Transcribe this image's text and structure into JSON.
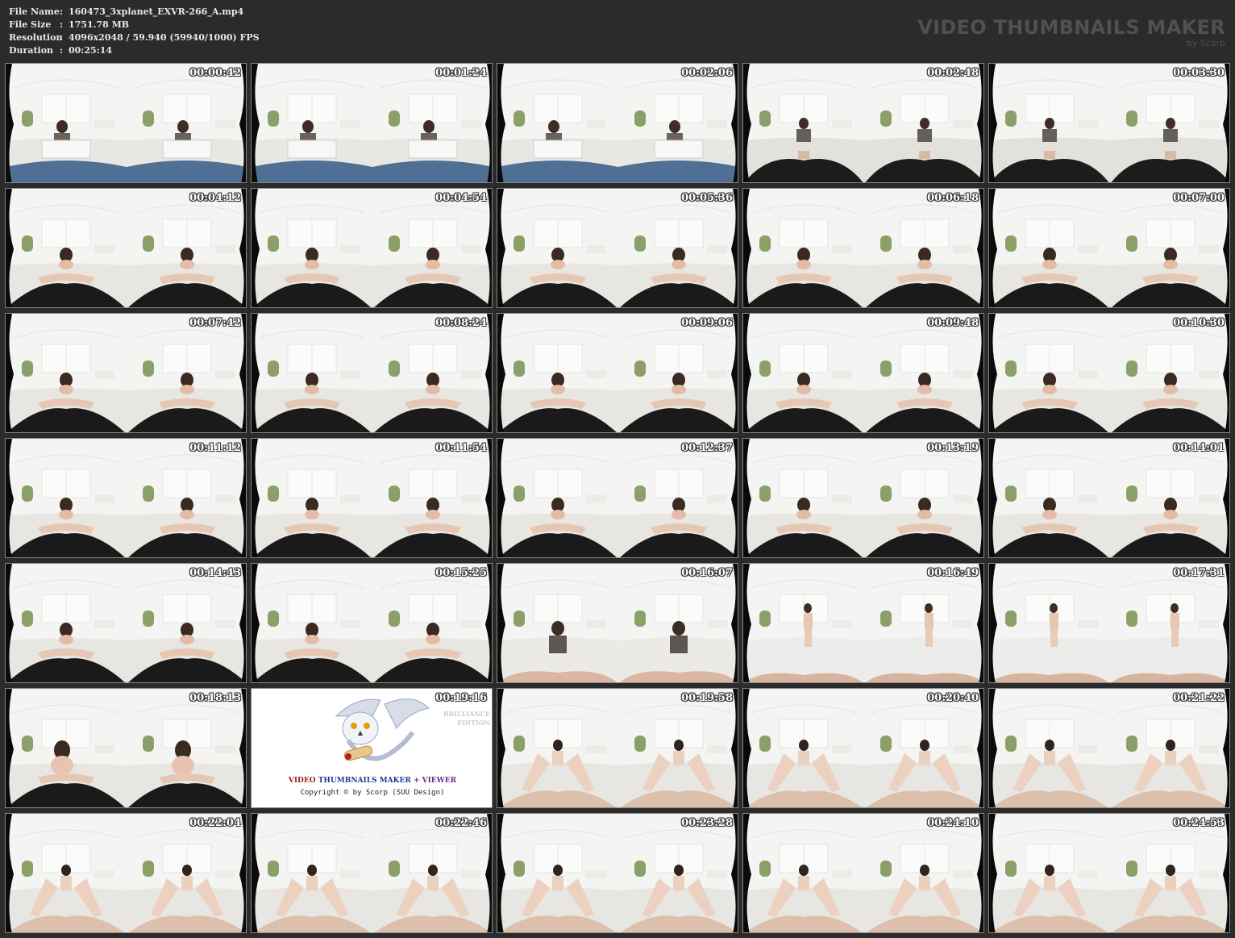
{
  "file_info": [
    {
      "label": "File Name",
      "sep": ":",
      "value": "160473_3xplanet_EXVR-266_A.mp4"
    },
    {
      "label": "File Size",
      "sep": ":",
      "value": "1751.78 MB"
    },
    {
      "label": "Resolution",
      "sep": ":",
      "value": "4096x2048 / 59.940 (59940/1000) FPS"
    },
    {
      "label": "Duration",
      "sep": ":",
      "value": "00:25:14"
    }
  ],
  "brand": {
    "title": "VIDEO THUMBNAILS MAKER",
    "subtitle": "by Scorp"
  },
  "thumbnails": [
    {
      "time": "00:00:42",
      "scene": "seated-box"
    },
    {
      "time": "00:01:24",
      "scene": "seated-box"
    },
    {
      "time": "00:02:06",
      "scene": "seated-box"
    },
    {
      "time": "00:02:48",
      "scene": "seated-far"
    },
    {
      "time": "00:03:30",
      "scene": "seated-far"
    },
    {
      "time": "00:04:12",
      "scene": "close"
    },
    {
      "time": "00:04:54",
      "scene": "close"
    },
    {
      "time": "00:05:36",
      "scene": "close"
    },
    {
      "time": "00:06:18",
      "scene": "close"
    },
    {
      "time": "00:07:00",
      "scene": "close"
    },
    {
      "time": "00:07:42",
      "scene": "close"
    },
    {
      "time": "00:08:24",
      "scene": "close"
    },
    {
      "time": "00:09:06",
      "scene": "close"
    },
    {
      "time": "00:09:48",
      "scene": "close"
    },
    {
      "time": "00:10:30",
      "scene": "close"
    },
    {
      "time": "00:11:12",
      "scene": "close"
    },
    {
      "time": "00:11:54",
      "scene": "close"
    },
    {
      "time": "00:12:37",
      "scene": "close"
    },
    {
      "time": "00:13:19",
      "scene": "close"
    },
    {
      "time": "00:14:01",
      "scene": "close"
    },
    {
      "time": "00:14:43",
      "scene": "close"
    },
    {
      "time": "00:15:25",
      "scene": "close"
    },
    {
      "time": "00:16:07",
      "scene": "kneel"
    },
    {
      "time": "00:16:49",
      "scene": "standing"
    },
    {
      "time": "00:17:31",
      "scene": "standing"
    },
    {
      "time": "00:18:13",
      "scene": "close-near"
    },
    {
      "time": "00:19:16",
      "scene": "promo"
    },
    {
      "time": "00:19:58",
      "scene": "legs"
    },
    {
      "time": "00:20:40",
      "scene": "legs"
    },
    {
      "time": "00:21:22",
      "scene": "legs"
    },
    {
      "time": "00:22:04",
      "scene": "legs"
    },
    {
      "time": "00:22:46",
      "scene": "legs"
    },
    {
      "time": "00:23:28",
      "scene": "legs"
    },
    {
      "time": "00:24:10",
      "scene": "legs"
    },
    {
      "time": "00:24:53",
      "scene": "legs"
    }
  ],
  "promo": {
    "line1_a": "VIDEO",
    "line1_b": " THUMBNAILS MAKER ",
    "line1_c": "+ VIEWER",
    "line2": "Copyright © by Scorp (SUU Design)",
    "edition_1": "BRILLIANCE",
    "edition_2": "EDITION"
  },
  "colors": {
    "background": "#2b2b2b",
    "info_text": "#e8e8e8",
    "brand_text": "#505050"
  }
}
